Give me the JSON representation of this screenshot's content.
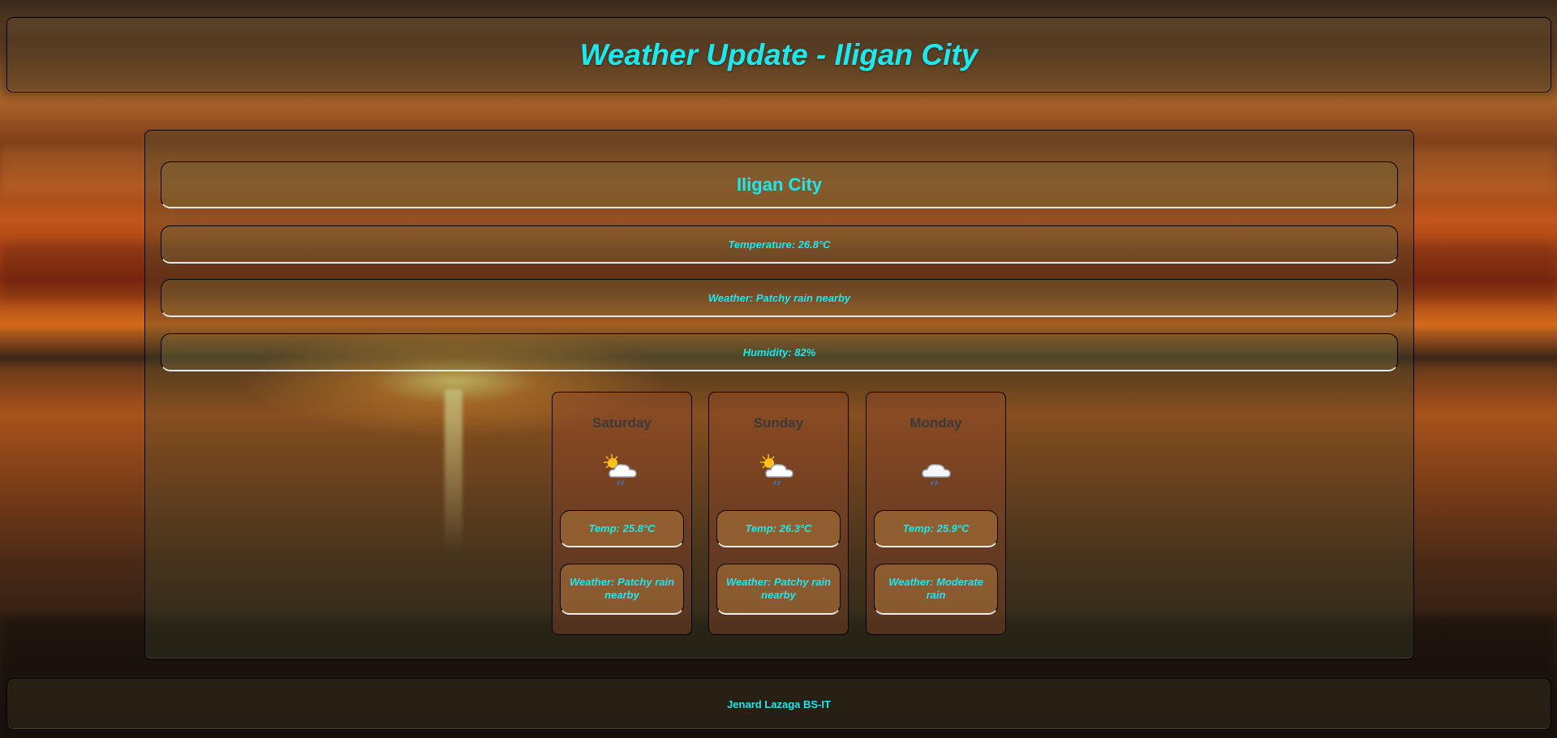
{
  "header": {
    "title": "Weather Update - Iligan City"
  },
  "current": {
    "city": "Iligan City",
    "temperature": "Temperature: 26.8°C",
    "weather": "Weather: Patchy rain nearby",
    "humidity": "Humidity: 82%"
  },
  "forecast": [
    {
      "day": "Saturday",
      "icon": "sun-cloud-rain-icon",
      "temp": "Temp: 25.8°C",
      "weather": "Weather: Patchy rain nearby"
    },
    {
      "day": "Sunday",
      "icon": "sun-cloud-rain-icon",
      "temp": "Temp: 26.3°C",
      "weather": "Weather: Patchy rain nearby"
    },
    {
      "day": "Monday",
      "icon": "cloud-rain-icon",
      "temp": "Temp: 25.9°C",
      "weather": "Weather: Moderate rain"
    }
  ],
  "footer": {
    "text": "Jenard Lazaga BS-IT"
  },
  "colors": {
    "accent": "#1de8ee",
    "day_name": "#3a3a3a"
  }
}
